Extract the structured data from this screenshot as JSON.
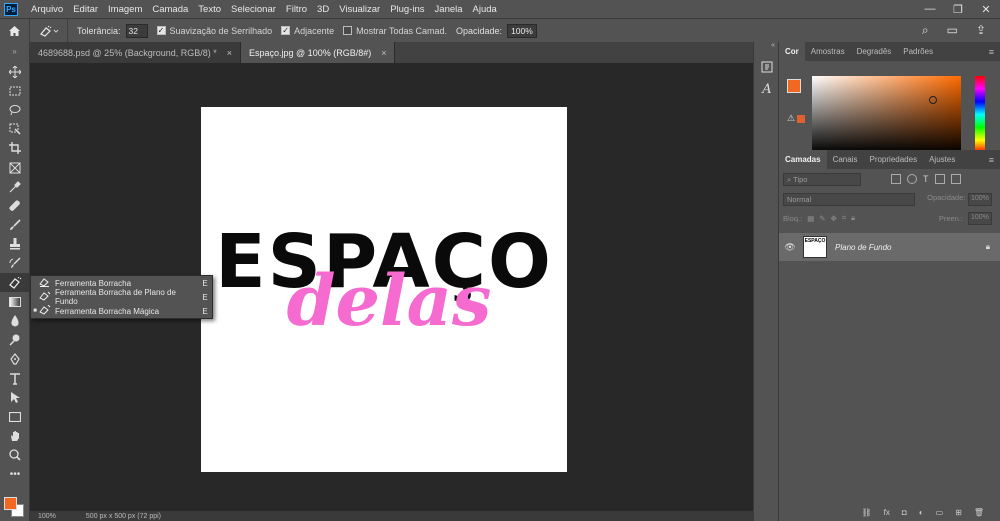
{
  "app": {
    "logo": "Ps",
    "menu": [
      "Arquivo",
      "Editar",
      "Imagem",
      "Camada",
      "Texto",
      "Selecionar",
      "Filtro",
      "3D",
      "Visualizar",
      "Plug-ins",
      "Janela",
      "Ajuda"
    ],
    "window_controls": [
      "—",
      "❐",
      "✕"
    ]
  },
  "options": {
    "tolerance_label": "Tolerância:",
    "tolerance_value": "32",
    "antialias_label": "Suavização de Serrilhado",
    "adjacent_label": "Adjacente",
    "sample_all_label": "Mostrar Todas Camad.",
    "opacity_label": "Opacidade:",
    "opacity_value": "100%"
  },
  "tabs": [
    {
      "label": "4689688.psd @ 25% (Background, RGB/8) *",
      "close": "×"
    },
    {
      "label": "Espaço.jpg @ 100% (RGB/8#)",
      "close": "×"
    }
  ],
  "flyout": {
    "items": [
      {
        "label": "Ferramenta Borracha",
        "key": "E",
        "selected": false
      },
      {
        "label": "Ferramenta Borracha de Plano de Fundo",
        "key": "E",
        "selected": false
      },
      {
        "label": "Ferramenta Borracha Mágica",
        "key": "E",
        "selected": true
      }
    ]
  },
  "artwork": {
    "word1": "ESPAÇO",
    "word2": "delas"
  },
  "status": {
    "zoom": "100%",
    "doc_size": "500 px x 500 px (72 ppi)"
  },
  "color_panel": {
    "tabs": [
      "Cor",
      "Amostras",
      "Degradês",
      "Padrões"
    ],
    "foreground": "#f26722",
    "background": "#ffffff"
  },
  "layers_panel": {
    "tabs": [
      "Camadas",
      "Canais",
      "Propriedades",
      "Ajustes"
    ],
    "search_placeholder": "Tipo",
    "blend_mode": "Normal",
    "opacity_label": "Opacidade:",
    "opacity_value": "100%",
    "lock_label": "Bloq.:",
    "fill_label": "Preen.:",
    "fill_value": "100%",
    "layer_name": "Plano de Fundo",
    "thumb_text": "ESPAÇO"
  },
  "colors": {
    "accent_orange": "#f26722",
    "artwork_pink": "#f56bcf",
    "artwork_black": "#0a0a0a"
  }
}
